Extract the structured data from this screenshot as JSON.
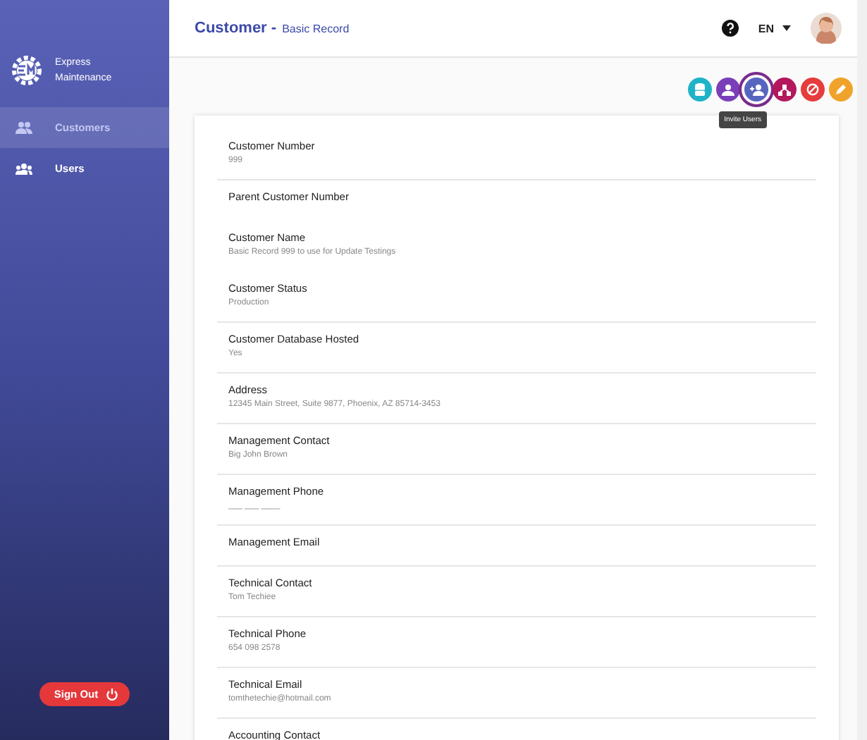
{
  "sidebar": {
    "brand": "Express Maintenance",
    "items": [
      {
        "label": "Customers",
        "kind": "people",
        "selected": true
      },
      {
        "label": "Users",
        "kind": "group",
        "selected": false
      }
    ],
    "sign_out": "Sign Out"
  },
  "header": {
    "title": "Customer",
    "separator": "-",
    "subtitle": "Basic Record",
    "language": "EN"
  },
  "actions": [
    {
      "kind": "database",
      "color": "#1fb3c8",
      "selected": false
    },
    {
      "kind": "person",
      "color": "#7a3fb8",
      "selected": false
    },
    {
      "kind": "invite",
      "color": "#5865c0",
      "selected": true
    },
    {
      "kind": "hierarchy",
      "color": "#b3175c",
      "selected": false
    },
    {
      "kind": "block",
      "color": "#e63c3c",
      "selected": false
    },
    {
      "kind": "edit",
      "color": "#f0a32a",
      "selected": false
    }
  ],
  "tooltip": "Invite Users",
  "fields": [
    {
      "label": "Customer Number",
      "value": "999",
      "divider": true
    },
    {
      "label": "Parent Customer Number",
      "divider": false
    },
    {
      "label": "Customer Name",
      "value": "Basic Record 999 to use for Update Testings",
      "divider": false
    },
    {
      "label": "Customer Status",
      "value": "Production",
      "divider": true
    },
    {
      "label": "Customer Database Hosted",
      "value": "Yes",
      "divider": true
    },
    {
      "label": "Address",
      "value": "12345 Main Street, Suite 9877, Phoenix, AZ 85714-3453",
      "divider": true
    },
    {
      "label": "Management Contact",
      "value": "Big John Brown",
      "divider": true
    },
    {
      "label": "Management Phone",
      "value": "___ ___ ____",
      "divider": true
    },
    {
      "label": "Management Email",
      "divider": true
    },
    {
      "label": "Technical Contact",
      "value": "Tom Techiee",
      "divider": true
    },
    {
      "label": "Technical Phone",
      "value": "654 098 2578",
      "divider": true
    },
    {
      "label": "Technical Email",
      "value": "tomthetechie@hotmail.com",
      "divider": true
    },
    {
      "label": "Accounting Contact"
    }
  ]
}
